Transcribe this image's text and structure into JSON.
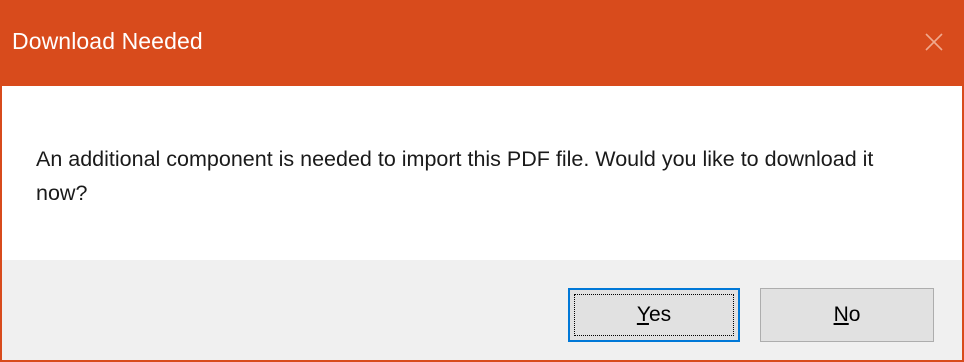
{
  "dialog": {
    "title": "Download Needed",
    "close_icon": "close-icon",
    "message": "An additional component is needed to import this PDF file. Would you like to download it now?",
    "buttons": {
      "yes": {
        "mnemonic": "Y",
        "rest": "es"
      },
      "no": {
        "mnemonic": "N",
        "rest": "o"
      }
    }
  },
  "colors": {
    "titlebar": "#d84b1c",
    "footer": "#f0f0f0",
    "button_face": "#e1e1e1",
    "focus_border": "#0078d7"
  }
}
